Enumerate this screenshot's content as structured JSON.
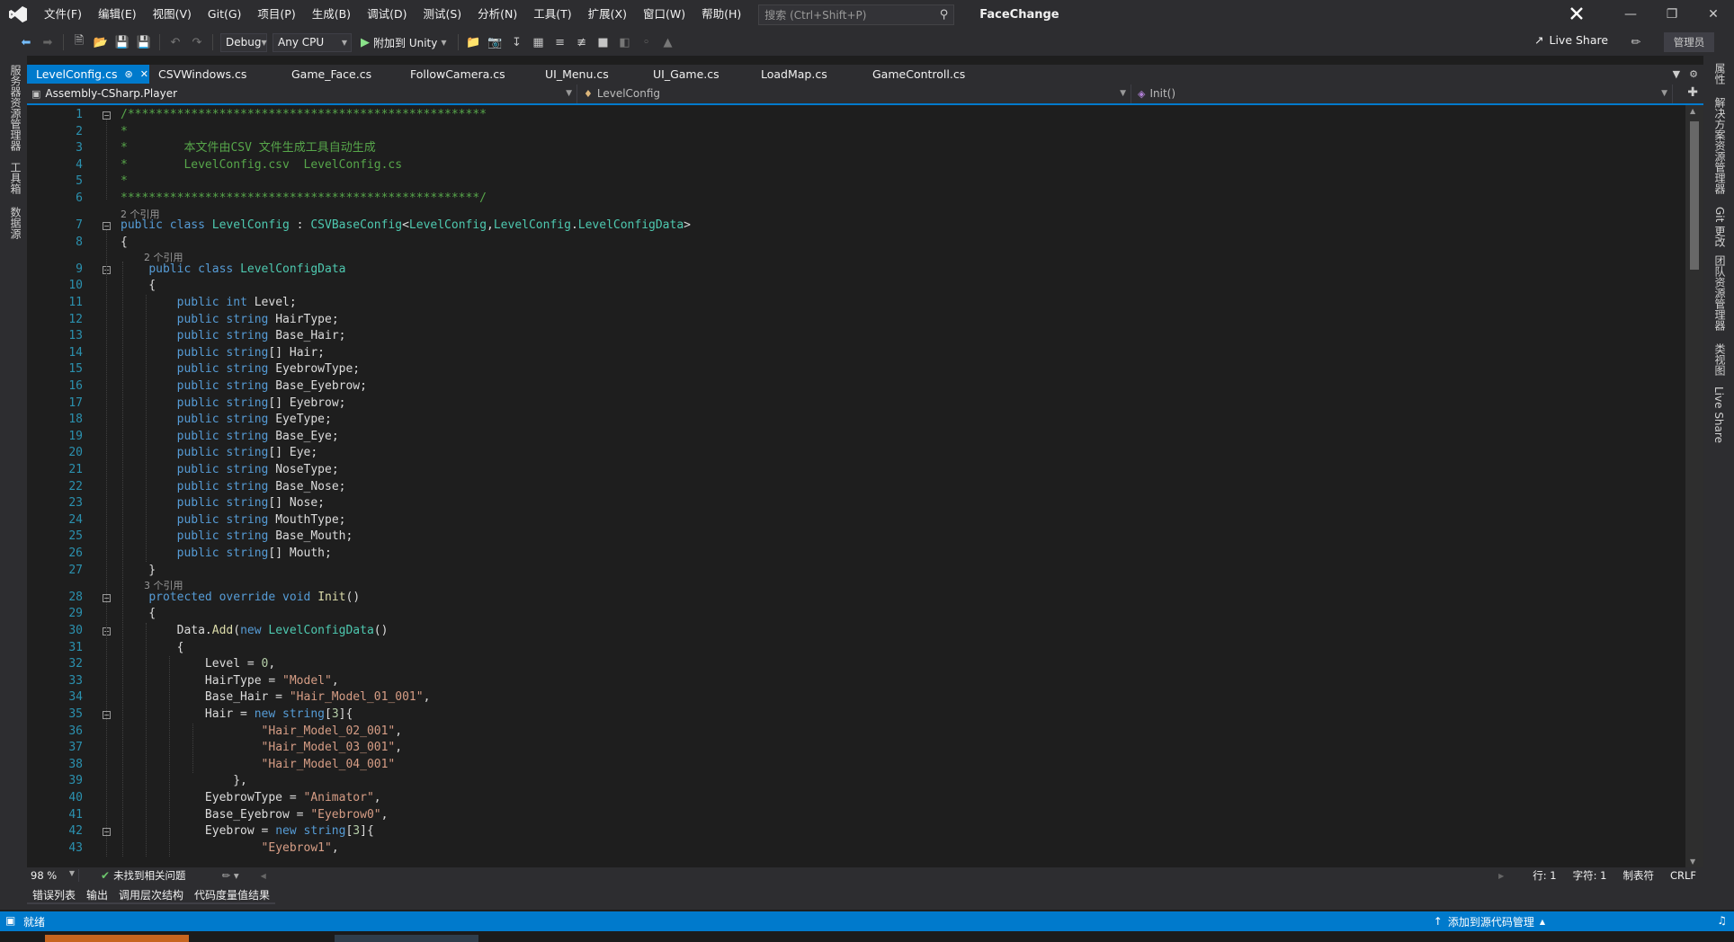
{
  "title_bar": {
    "menu": [
      "文件(F)",
      "编辑(E)",
      "视图(V)",
      "Git(G)",
      "项目(P)",
      "生成(B)",
      "调试(D)",
      "测试(S)",
      "分析(N)",
      "工具(T)",
      "扩展(X)",
      "窗口(W)",
      "帮助(H)"
    ],
    "search_placeholder": "搜索 (Ctrl+Shift+P)",
    "solution_name": "FaceChange",
    "profile_initial": "X"
  },
  "toolbar": {
    "config": "Debug",
    "platform": "Any CPU",
    "attach_label": "附加到 Unity",
    "live_share": "Live Share",
    "admin": "管理员"
  },
  "left_rail": [
    "服务器资源管理器",
    "工具箱",
    "数据源"
  ],
  "right_rail": [
    "属性",
    "解决方案资源管理器",
    "Git 更改",
    "团队资源管理器",
    "类视图",
    "Live Share"
  ],
  "tabs": [
    {
      "label": "LevelConfig.cs",
      "active": true
    },
    {
      "label": "CSVWindows.cs"
    },
    {
      "label": "Game_Face.cs"
    },
    {
      "label": "FollowCamera.cs"
    },
    {
      "label": "UI_Menu.cs"
    },
    {
      "label": "UI_Game.cs"
    },
    {
      "label": "LoadMap.cs"
    },
    {
      "label": "GameControll.cs"
    }
  ],
  "navbar": {
    "project": "Assembly-CSharp.Player",
    "type": "LevelConfig",
    "member": "Init()"
  },
  "editor": {
    "references": {
      "r7": "2 个引用",
      "r9": "2 个引用",
      "r28": "3 个引用"
    },
    "lines": [
      "/***************************************************",
      "*",
      "*        本文件由CSV 文件生成工具自动生成",
      "*        LevelConfig.csv  LevelConfig.cs",
      "*",
      "***************************************************/",
      "public class LevelConfig : CSVBaseConfig<LevelConfig,LevelConfig.LevelConfigData>",
      "{",
      "    public class LevelConfigData",
      "    {",
      "        public int Level;",
      "        public string HairType;",
      "        public string Base_Hair;",
      "        public string[] Hair;",
      "        public string EyebrowType;",
      "        public string Base_Eyebrow;",
      "        public string[] Eyebrow;",
      "        public string EyeType;",
      "        public string Base_Eye;",
      "        public string[] Eye;",
      "        public string NoseType;",
      "        public string Base_Nose;",
      "        public string[] Nose;",
      "        public string MouthType;",
      "        public string Base_Mouth;",
      "        public string[] Mouth;",
      "    }",
      "    protected override void Init()",
      "    {",
      "        Data.Add(new LevelConfigData()",
      "        {",
      "            Level = 0,",
      "            HairType = \"Model\",",
      "            Base_Hair = \"Hair_Model_01_001\",",
      "            Hair = new string[3]{",
      "                    \"Hair_Model_02_001\",",
      "                    \"Hair_Model_03_001\",",
      "                    \"Hair_Model_04_001\"",
      "                },",
      "            EyebrowType = \"Animator\",",
      "            Base_Eyebrow = \"Eyebrow0\",",
      "            Eyebrow = new string[3]{",
      "                    \"Eyebrow1\","
    ]
  },
  "editor_status": {
    "zoom": "98 %",
    "issues": "未找到相关问题",
    "line": "行: 1",
    "char": "字符: 1",
    "tabs": "制表符",
    "eol": "CRLF"
  },
  "bottom_tabs": [
    "错误列表",
    "输出",
    "调用层次结构",
    "代码度量值结果"
  ],
  "status_bar": {
    "ready": "就绪",
    "source_control": "添加到源代码管理"
  },
  "colors": {
    "accent": "#007acc",
    "keyword": "#569cd6",
    "type": "#4ec9b0",
    "string": "#d69d85",
    "comment": "#57a64a",
    "line_number": "#2b91af"
  }
}
